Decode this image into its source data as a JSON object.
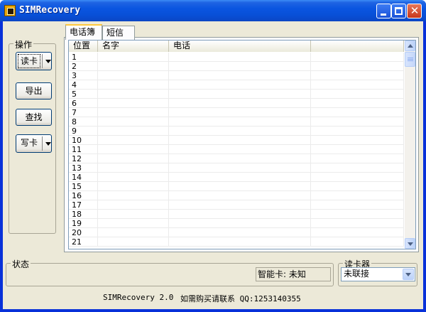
{
  "window": {
    "title": "SIMRecovery",
    "icon": "app-icon"
  },
  "sidebar": {
    "group_label": "操作",
    "read_card": "读卡",
    "export": "导出",
    "find": "查找",
    "write_card": "写卡"
  },
  "tabs": [
    {
      "label": "电话簿",
      "active": true
    },
    {
      "label": "短信",
      "active": false
    }
  ],
  "table": {
    "columns": [
      "位置",
      "名字",
      "电话",
      ""
    ],
    "rows": [
      "1",
      "2",
      "3",
      "4",
      "5",
      "6",
      "7",
      "8",
      "9",
      "10",
      "11",
      "12",
      "13",
      "14",
      "15",
      "16",
      "17",
      "18",
      "19",
      "20",
      "21"
    ]
  },
  "status": {
    "group_label": "状态",
    "smartcard_label": "智能卡: 未知"
  },
  "reader": {
    "group_label": "读卡器",
    "selected": "未联接"
  },
  "footer": {
    "version": "SIMRecovery 2.0",
    "contact": "如需购买请联系 QQ:1253140355"
  },
  "colors": {
    "titlebar": "#0a55e0",
    "face": "#ece9d8",
    "accent_tab": "#ffc83c"
  }
}
